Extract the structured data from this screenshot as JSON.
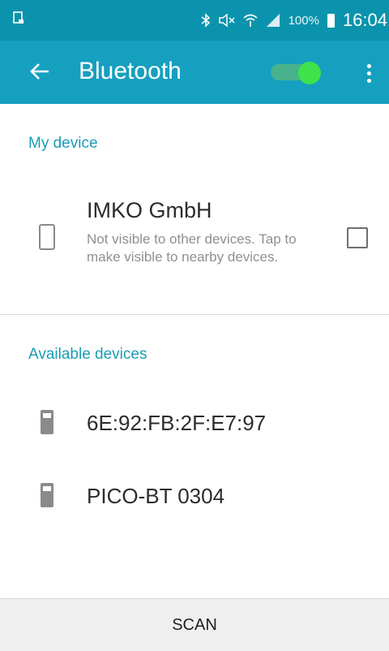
{
  "status_bar": {
    "icons": [
      "screenshot-icon",
      "bluetooth-icon",
      "mute-icon",
      "wifi-icon",
      "signal-icon",
      "battery-icon"
    ],
    "battery": "100%",
    "time": "16:04"
  },
  "app_bar": {
    "title": "Bluetooth",
    "bluetooth_toggle_on": true,
    "colors": {
      "status": "#0b93ad",
      "bar": "#16a0bf",
      "toggle_thumb": "#3ee24a"
    }
  },
  "my_device": {
    "header": "My device",
    "name": "IMKO GmbH",
    "description": "Not visible to other devices. Tap to make visible to nearby devices.",
    "visible_checked": false
  },
  "available": {
    "header": "Available devices",
    "items": [
      {
        "label": "6E:92:FB:2F:E7:97",
        "icon": "device-icon"
      },
      {
        "label": "PICO-BT 0304",
        "icon": "device-icon"
      }
    ]
  },
  "footer": {
    "scan_label": "SCAN"
  }
}
